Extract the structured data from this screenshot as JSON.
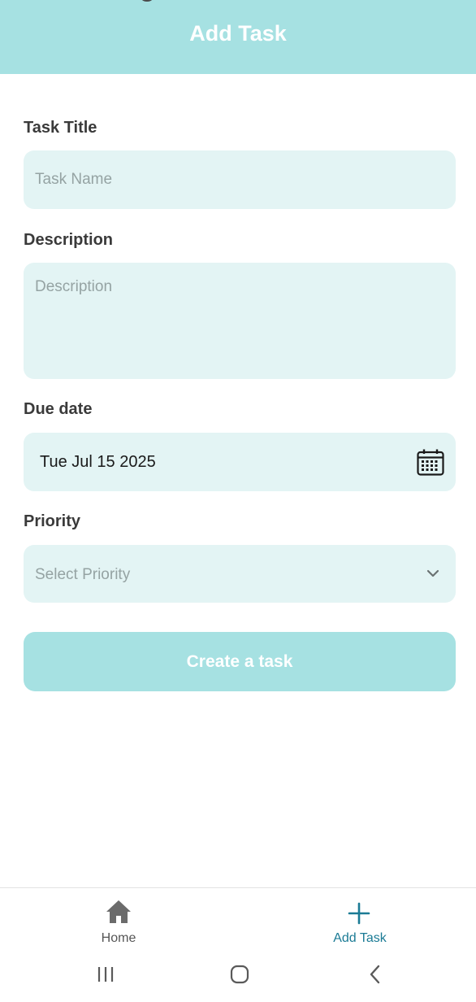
{
  "header": {
    "title": "Add Task"
  },
  "form": {
    "title_label": "Task Title",
    "title_placeholder": "Task Name",
    "description_label": "Description",
    "description_placeholder": "Description",
    "due_date_label": "Due date",
    "due_date_value": "Tue Jul 15 2025",
    "priority_label": "Priority",
    "priority_placeholder": "Select Priority",
    "submit_label": "Create a task"
  },
  "nav": {
    "items": [
      {
        "label": "Home",
        "icon": "home-icon",
        "active": false
      },
      {
        "label": "Add Task",
        "icon": "plus-icon",
        "active": true
      }
    ]
  },
  "system_nav": {
    "buttons": [
      "recents-icon",
      "home-circle-icon",
      "back-icon"
    ]
  },
  "colors": {
    "accent": "#a6e1e2",
    "field_bg": "#e3f4f4",
    "active_nav": "#1b7b95"
  }
}
